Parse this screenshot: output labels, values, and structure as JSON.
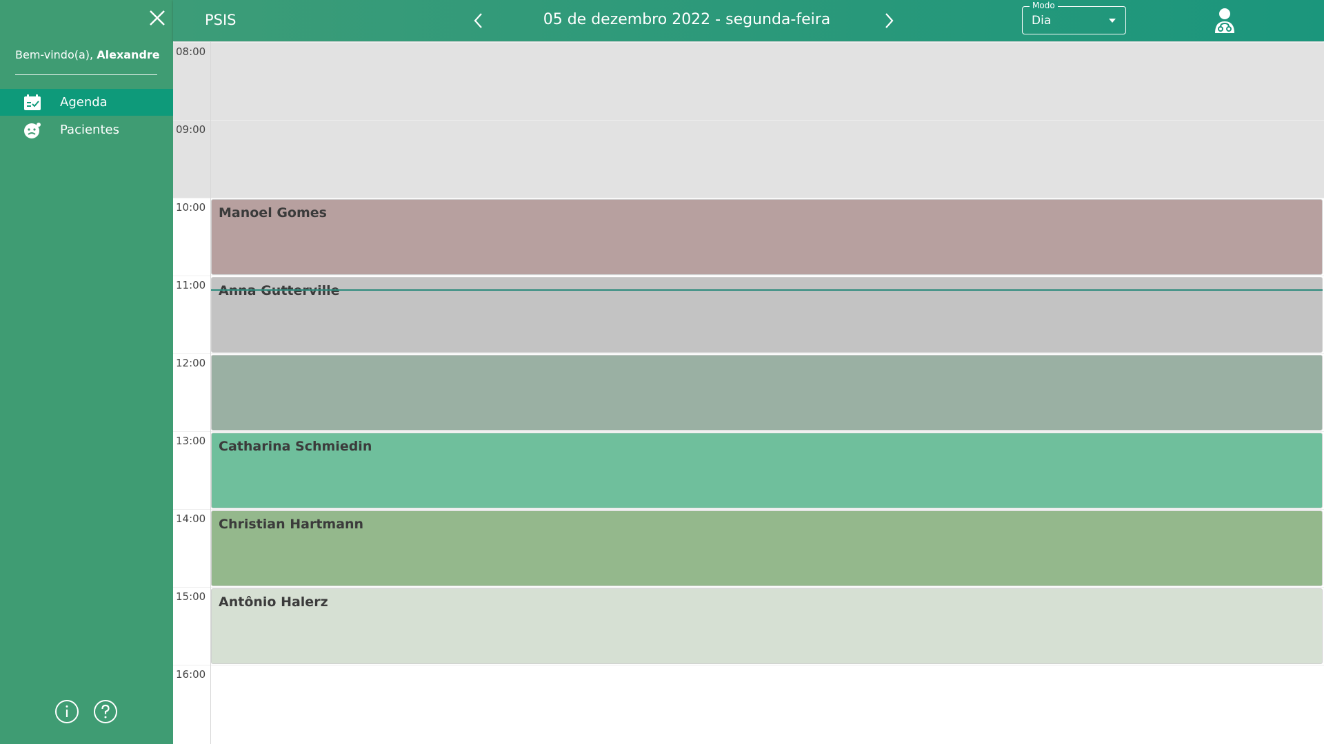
{
  "app": {
    "title": "PSIS"
  },
  "sidebar": {
    "welcome_prefix": "Bem-vindo(a), ",
    "welcome_name": "Alexandre",
    "items": [
      {
        "label": "Agenda",
        "icon": "calendar-check-icon",
        "active": true
      },
      {
        "label": "Pacientes",
        "icon": "patients-face-icon",
        "active": false
      }
    ]
  },
  "header": {
    "date": "05 de dezembro 2022 - segunda-feira",
    "mode_label": "Modo",
    "mode_value": "Dia"
  },
  "calendar": {
    "hours": [
      "08:00",
      "09:00",
      "10:00",
      "11:00",
      "12:00",
      "13:00",
      "14:00",
      "15:00",
      "16:00"
    ],
    "events": [
      {
        "name": "Manoel Gomes",
        "start": "10:00",
        "color": "#b7a09f"
      },
      {
        "name": "Anna Gutterville",
        "start": "11:00",
        "color": "#c3c3c3"
      },
      {
        "name": "",
        "start": "12:00",
        "color": "#9ab0a3"
      },
      {
        "name": "Catharina Schmiedin",
        "start": "13:00",
        "color": "#6fbf9c"
      },
      {
        "name": "Christian Hartmann",
        "start": "14:00",
        "color": "#94b88c"
      },
      {
        "name": "Antônio Halerz",
        "start": "15:00",
        "color": "#d6e0d3"
      }
    ]
  },
  "colors": {
    "sidebar_bg": "#3f9c73",
    "sidebar_active": "#0e9a7a",
    "header_bg": "#1b967c",
    "past_bg": "#e2e2e2"
  }
}
